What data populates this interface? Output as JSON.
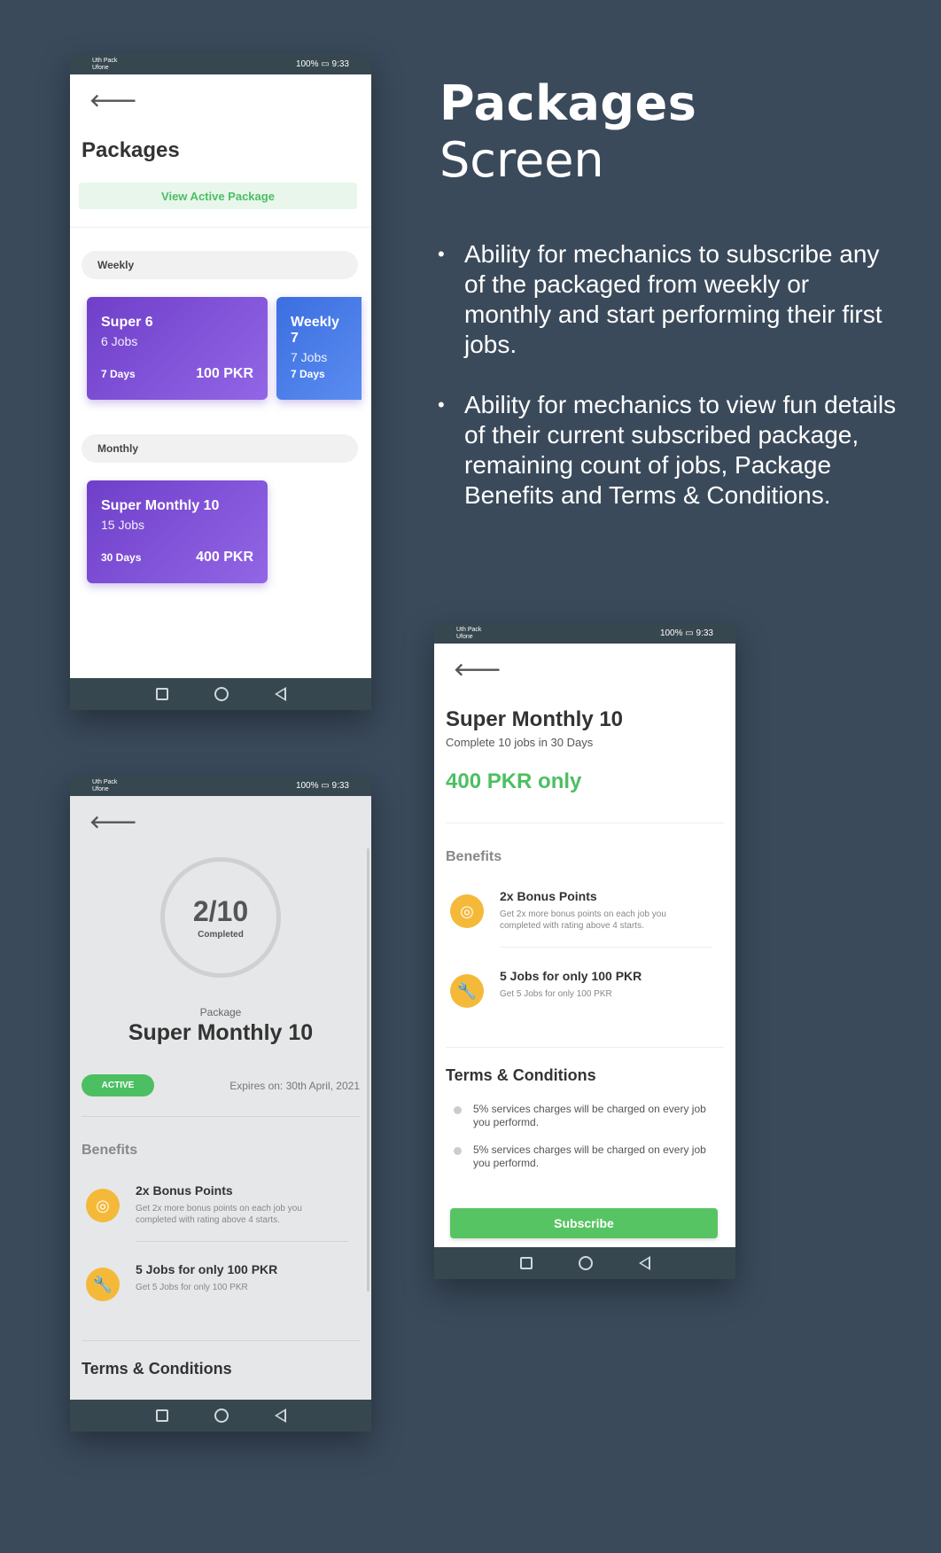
{
  "hero": {
    "title": "Packages",
    "subtitle": "Screen",
    "bullets": [
      "Ability for mechanics to subscribe any of the packaged from weekly or monthly and start performing their first jobs.",
      "Ability for mechanics to view fun details of their current subscribed package, remaining count of jobs, Package Benefits and Terms & Conditions."
    ]
  },
  "status_bar": {
    "carrier": "Uth Pack",
    "carrier2": "Ufone",
    "battery": "100%",
    "time": "9:33"
  },
  "packages_screen": {
    "title": "Packages",
    "view_active_label": "View Active Package",
    "weekly_label": "Weekly",
    "monthly_label": "Monthly",
    "weekly_cards": [
      {
        "name": "Super 6",
        "jobs": "6 Jobs",
        "days": "7 Days",
        "price": "100 PKR"
      },
      {
        "name": "Weekly 7",
        "jobs": "7 Jobs",
        "days": "7 Days",
        "price": ""
      }
    ],
    "monthly_cards": [
      {
        "name": "Super Monthly 10",
        "jobs": "15 Jobs",
        "days": "30 Days",
        "price": "400 PKR"
      }
    ]
  },
  "active_screen": {
    "progress_text": "2/10",
    "progress_label": "Completed",
    "package_caption": "Package",
    "package_name": "Super Monthly 10",
    "status_badge": "ACTIVE",
    "expires": "Expires on: 30th April, 2021",
    "benefits_heading": "Benefits",
    "benefits": [
      {
        "icon": "coins-icon",
        "title": "2x Bonus Points",
        "desc": "Get 2x more bonus points on each job you completed with rating above 4 starts."
      },
      {
        "icon": "wrench-icon",
        "title": "5 Jobs for only 100 PKR",
        "desc": "Get 5 Jobs for only 100 PKR"
      }
    ],
    "terms_heading": "Terms & Conditions"
  },
  "detail_screen": {
    "title": "Super Monthly 10",
    "subtitle": "Complete 10 jobs in 30 Days",
    "price": "400 PKR only",
    "benefits_heading": "Benefits",
    "benefits": [
      {
        "icon": "coins-icon",
        "title": "2x Bonus Points",
        "desc": "Get 2x more bonus points on each job you completed with rating above 4 starts."
      },
      {
        "icon": "wrench-icon",
        "title": "5 Jobs for only 100 PKR",
        "desc": "Get 5 Jobs for only 100 PKR"
      }
    ],
    "terms_heading": "Terms & Conditions",
    "terms": [
      "5% services charges will be charged on every job you performd.",
      "5% services charges will be charged on every job you performd."
    ],
    "subscribe_label": "Subscribe"
  },
  "colors": {
    "background": "#3a4a5b",
    "accent_green": "#4cbf63",
    "card_purple": "#7b4fd6",
    "card_blue": "#3b6fe0",
    "icon_orange": "#f5b93a",
    "system_bar": "#37474f"
  }
}
